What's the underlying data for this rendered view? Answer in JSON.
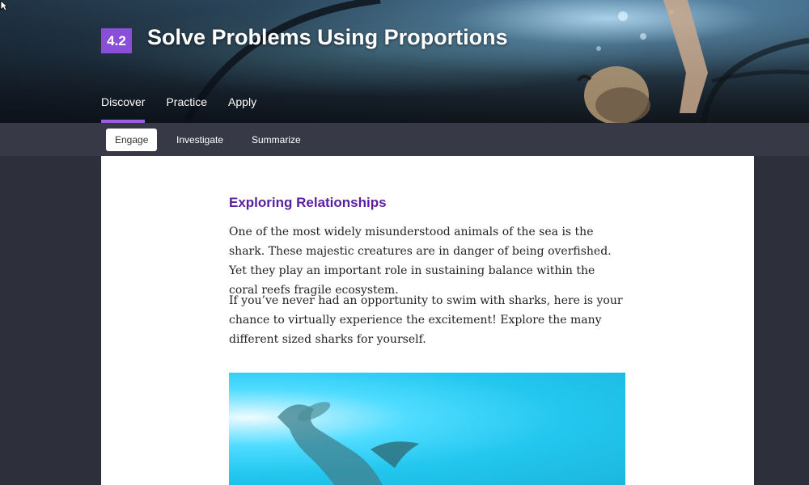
{
  "lesson": {
    "number": "4.2",
    "title": "Solve Problems Using Proportions"
  },
  "main_tabs": [
    {
      "label": "Discover",
      "active": true
    },
    {
      "label": "Practice",
      "active": false
    },
    {
      "label": "Apply",
      "active": false
    }
  ],
  "sub_tabs": [
    {
      "label": "Engage",
      "active": true
    },
    {
      "label": "Investigate",
      "active": false
    },
    {
      "label": "Summarize",
      "active": false
    }
  ],
  "content": {
    "heading": "Exploring Relationships",
    "paragraphs": [
      "One of the most widely misunderstood animals of the sea is the shark. These majestic creatures are in danger of being overfished. Yet they play an important role in sustaining balance within the coral reefs fragile ecosystem.",
      "If you’ve never had an opportunity to swim with sharks, here is your chance to virtually experience the excitement! Explore the many different sized sharks for yourself."
    ]
  },
  "colors": {
    "accent": "#8a4fd8",
    "heading": "#5a1fa0",
    "subbar": "#373946",
    "background": "#2d2f3a"
  },
  "media": {
    "icon": "hammerhead-shark-image"
  }
}
